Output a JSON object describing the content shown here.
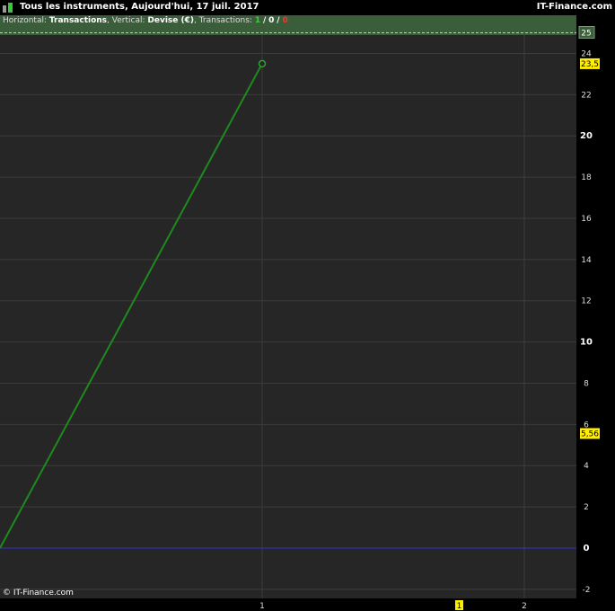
{
  "header": {
    "title": "Tous les instruments, Aujourd'hui, 17 juil. 2017",
    "brand": "IT-Finance.com"
  },
  "info": {
    "horizontal_label": "Horizontal:",
    "horizontal_value": "Transactions",
    "vertical_label": "Vertical:",
    "vertical_value": "Devise (€)",
    "transactions_label": "Transactions:",
    "count_win": "1",
    "count_even": "0",
    "count_loss": "0",
    "sep": "/"
  },
  "footer": {
    "copyright": "© IT-Finance.com"
  },
  "colors": {
    "background": "#262626",
    "grid": "#3c3c3c",
    "line": "#1e8a1e",
    "zero_line": "#2a35c8",
    "label_highlight": "#ffee00",
    "axis_text": "#dddddd"
  },
  "chart_data": {
    "type": "line",
    "title": "",
    "xlabel": "Transactions",
    "ylabel": "Devise (€)",
    "xlim": [
      0,
      2.2
    ],
    "ylim": [
      -2,
      26
    ],
    "x_ticks": [
      "1",
      "2"
    ],
    "y_ticks": [
      "24",
      "22",
      "20",
      "18",
      "16",
      "14",
      "12",
      "10",
      "8",
      "6",
      "4",
      "2",
      "0",
      "-2"
    ],
    "bold_y_ticks": [
      "20",
      "10",
      "0"
    ],
    "series": [
      {
        "x": [
          0,
          1
        ],
        "y": [
          0,
          23.5
        ]
      }
    ],
    "level_line_label": "25",
    "level_line_value": 25,
    "last_value_label": "23,5",
    "last_value": 23.5,
    "marker_value_label": "5,56",
    "marker_value": 5.56,
    "x_marker_label": "1",
    "x_marker_value": 1.75
  }
}
